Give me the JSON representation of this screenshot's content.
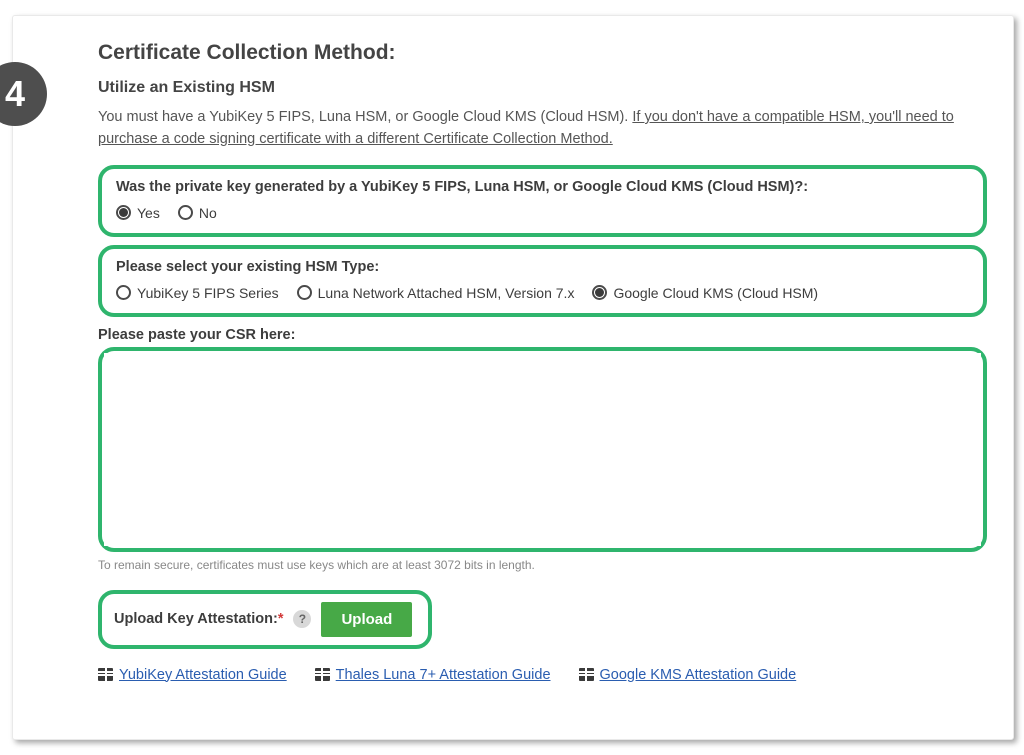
{
  "step_number": "4",
  "title": "Certificate Collection Method:",
  "subtitle": "Utilize an Existing HSM",
  "intro_pre": "You must have a YubiKey 5 FIPS, Luna HSM, or Google Cloud KMS (Cloud HSM). ",
  "intro_link": "If you don't have a compatible HSM, you'll need to purchase a code signing certificate with a different Certificate Collection Method.",
  "question_generated": {
    "label": "Was the private key generated by a YubiKey 5 FIPS, Luna HSM, or Google Cloud KMS (Cloud HSM)?:",
    "options": [
      {
        "label": "Yes",
        "selected": true
      },
      {
        "label": "No",
        "selected": false
      }
    ]
  },
  "question_hsm_type": {
    "label": "Please select your existing HSM Type:",
    "options": [
      {
        "label": "YubiKey 5 FIPS Series",
        "selected": false
      },
      {
        "label": "Luna Network Attached HSM, Version 7.x",
        "selected": false
      },
      {
        "label": "Google Cloud KMS (Cloud HSM)",
        "selected": true
      }
    ]
  },
  "csr_label": "Please paste your CSR here:",
  "csr_value": "",
  "csr_hint": "To remain secure, certificates must use keys which are at least 3072 bits in length.",
  "upload": {
    "label": "Upload Key Attestation:",
    "required_mark": "*",
    "button": "Upload"
  },
  "guides": [
    "YubiKey Attestation Guide",
    "Thales Luna 7+ Attestation Guide",
    "Google KMS Attestation Guide"
  ]
}
